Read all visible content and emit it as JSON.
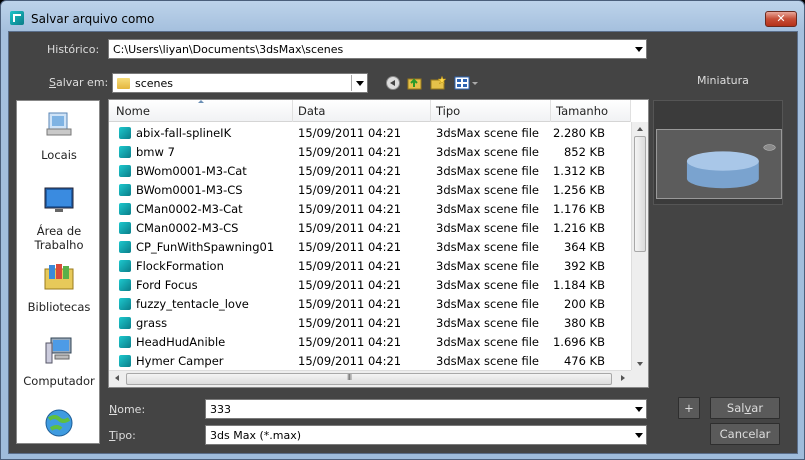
{
  "window": {
    "title": "Salvar arquivo como",
    "close_label": "✕"
  },
  "history": {
    "label": "Histórico:",
    "value": "C:\\Users\\liyan\\Documents\\3dsMax\\scenes"
  },
  "save_in": {
    "label_prefix": "",
    "label_ul": "S",
    "label_rest": "alvar em:",
    "value": "scenes"
  },
  "thumbnail": {
    "label": "Miniatura"
  },
  "places": [
    {
      "label": "Locais"
    },
    {
      "label": "Área de\nTrabalho"
    },
    {
      "label": "Bibliotecas"
    },
    {
      "label": "Computador"
    }
  ],
  "columns": {
    "name": "Nome",
    "date": "Data",
    "type": "Tipo",
    "size": "Tamanho"
  },
  "files": [
    {
      "name": "abix-fall-splineIK",
      "date": "15/09/2011 04:21",
      "type": "3dsMax scene file",
      "size": "2.280 KB"
    },
    {
      "name": "bmw 7",
      "date": "15/09/2011 04:21",
      "type": "3dsMax scene file",
      "size": "852 KB"
    },
    {
      "name": "BWom0001-M3-Cat",
      "date": "15/09/2011 04:21",
      "type": "3dsMax scene file",
      "size": "1.312 KB"
    },
    {
      "name": "BWom0001-M3-CS",
      "date": "15/09/2011 04:21",
      "type": "3dsMax scene file",
      "size": "1.256 KB"
    },
    {
      "name": "CMan0002-M3-Cat",
      "date": "15/09/2011 04:21",
      "type": "3dsMax scene file",
      "size": "1.176 KB"
    },
    {
      "name": "CMan0002-M3-CS",
      "date": "15/09/2011 04:21",
      "type": "3dsMax scene file",
      "size": "1.216 KB"
    },
    {
      "name": "CP_FunWithSpawning01",
      "date": "15/09/2011 04:21",
      "type": "3dsMax scene file",
      "size": "364 KB"
    },
    {
      "name": "FlockFormation",
      "date": "15/09/2011 04:21",
      "type": "3dsMax scene file",
      "size": "392 KB"
    },
    {
      "name": "Ford Focus",
      "date": "15/09/2011 04:21",
      "type": "3dsMax scene file",
      "size": "1.184 KB"
    },
    {
      "name": "fuzzy_tentacle_love",
      "date": "15/09/2011 04:21",
      "type": "3dsMax scene file",
      "size": "200 KB"
    },
    {
      "name": "grass",
      "date": "15/09/2011 04:21",
      "type": "3dsMax scene file",
      "size": "380 KB"
    },
    {
      "name": "HeadHudAnible",
      "date": "15/09/2011 04:21",
      "type": "3dsMax scene file",
      "size": "1.696 KB"
    },
    {
      "name": "Hymer Camper",
      "date": "15/09/2011 04:21",
      "type": "3dsMax scene file",
      "size": "476 KB"
    }
  ],
  "hscroll_grip": "III",
  "filename": {
    "label_ul": "N",
    "label_rest": "ome:",
    "value": "333"
  },
  "filetype": {
    "label_ul": "T",
    "label_rest": "ipo:",
    "value": "3ds Max (*.max)"
  },
  "buttons": {
    "plus": "+",
    "save_ul": "v",
    "save_pre": "Sal",
    "save_post": "ar",
    "cancel": "Cancelar"
  },
  "colors": {
    "client_bg": "#444444",
    "title_gradient": "#bdd3ea",
    "close_red": "#c74e37"
  }
}
